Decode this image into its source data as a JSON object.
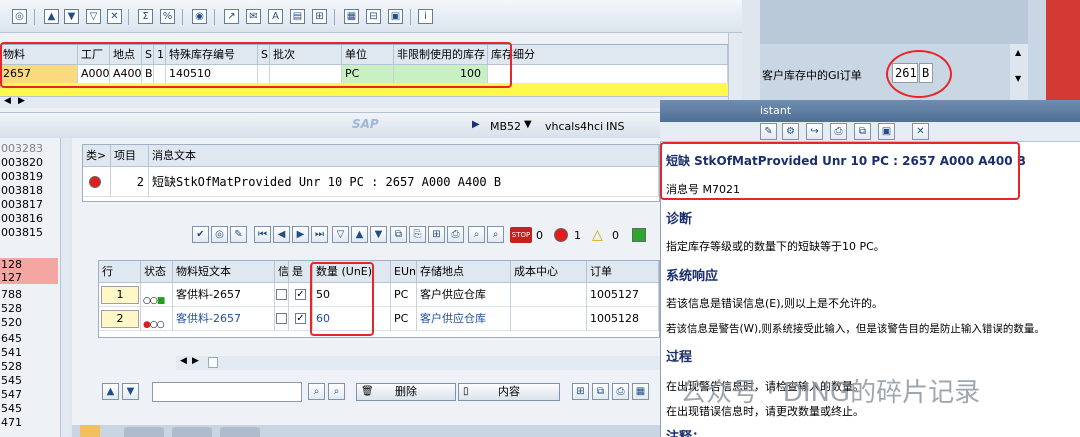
{
  "mb52": {
    "columns": [
      "物料",
      "工厂",
      "地点",
      "S",
      "1",
      "特殊库存编号",
      "S",
      "批次",
      "单位",
      "非限制使用的库存",
      "库存细分"
    ],
    "row": [
      "2657",
      "A000",
      "A400",
      "B",
      "",
      "140510",
      "",
      "",
      "PC",
      "100",
      ""
    ]
  },
  "right_top": {
    "label": "客户库存中的GI订单",
    "value": "261",
    "code": "B"
  },
  "statusbar": {
    "logo": "SAP",
    "tcode": "MB52",
    "server": "vhcals4hci",
    "mode": "INS"
  },
  "left_numbers": [
    "003283",
    "003820",
    "003819",
    "003818",
    "003817",
    "003816",
    "003815",
    "",
    "128",
    "127",
    "788",
    "528",
    "520",
    "645",
    "541",
    "528",
    "545",
    "547",
    "545",
    "471"
  ],
  "messages": {
    "columns": [
      "类>",
      "项目",
      "消息文本"
    ],
    "row": {
      "item": "2",
      "text": "短缺StkOfMatProvided Unr 10 PC : 2657 A000 A400 B"
    }
  },
  "toolbar2": {
    "stop_count": "0",
    "error_count": "1",
    "warning_count": "0"
  },
  "items": {
    "columns": [
      "行",
      "状态",
      "物料短文本",
      "信",
      "是",
      "数量 (UnE)",
      "EUn",
      "存储地点",
      "成本中心",
      "订单"
    ],
    "rows": [
      {
        "line": "1",
        "text": "客供料-2657",
        "qty": "50",
        "unit": "PC",
        "sloc": "客户供应仓库",
        "order": "1005127"
      },
      {
        "line": "2",
        "text": "客供料-2657",
        "qty": "60",
        "unit": "PC",
        "sloc": "客户供应仓库",
        "order": "1005128"
      }
    ]
  },
  "bottom_buttons": {
    "delete": "删除",
    "content": "内容"
  },
  "help": {
    "title": "istant",
    "message": "短缺 StkOfMatProvided Unr 10 PC : 2657 A000 A400 B",
    "msg_no": "消息号 M7021",
    "h_diag": "诊断",
    "diag": "指定库存等级或的数量下的短缺等于10 PC。",
    "h_resp": "系统响应",
    "resp1": "若该信息是错误信息(E),则以上是不允许的。",
    "resp2": "若该信息是警告(W),则系统接受此输入，但是该警告目的是防止输入错误的数量。",
    "h_proc": "过程",
    "proc1": "在出现警告信息时，请检查输入的数量。",
    "proc2": "在出现错误信息时，请更改数量或终止。",
    "h_note": "注释："
  },
  "watermark": "公众号 · DING的碎片记录",
  "colors": {
    "highlight": "#e8262a",
    "sap_blue": "#1a2f6e",
    "row_yellow": "#fff94d"
  }
}
